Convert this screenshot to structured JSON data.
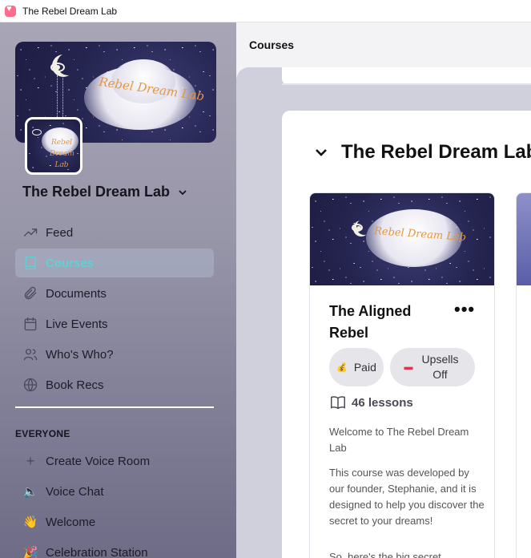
{
  "window": {
    "title": "The Rebel Dream Lab"
  },
  "sidebar": {
    "banner_text": "Rebel Dream Lab",
    "avatar_text": "Rebel Dream Lab",
    "community_name": "The Rebel Dream Lab",
    "nav": [
      {
        "label": "Feed",
        "icon": "trending-up-icon"
      },
      {
        "label": "Courses",
        "icon": "book-icon",
        "active": true
      },
      {
        "label": "Documents",
        "icon": "paperclip-icon"
      },
      {
        "label": "Live Events",
        "icon": "calendar-icon"
      },
      {
        "label": "Who's Who?",
        "icon": "users-icon"
      },
      {
        "label": "Book Recs",
        "icon": "globe-icon"
      }
    ],
    "section_label": "EVERYONE",
    "section_items": [
      {
        "label": "Create Voice Room",
        "icon": "plus-icon"
      },
      {
        "label": "Voice Chat",
        "icon": "speaker-icon"
      },
      {
        "label": "Welcome",
        "icon": "wave-icon"
      },
      {
        "label": "Celebration Station",
        "icon": "party-icon"
      }
    ],
    "active_color": "#5fd1d6"
  },
  "main": {
    "page_title": "Courses",
    "group_title": "The Rebel Dream Lab",
    "course": {
      "image_text": "Rebel Dream Lab",
      "title": "The Aligned Rebel",
      "more_label": "•••",
      "paid_label": "Paid",
      "upsells_label": "Upsells Off",
      "lessons_label": "46 lessons",
      "desc_1": "Welcome to The Rebel Dream Lab",
      "desc_2": "This course was developed by our founder, Stephanie, and it is designed to help you discover the secret to your dreams!",
      "desc_3": "So, here's the big secret..."
    }
  }
}
